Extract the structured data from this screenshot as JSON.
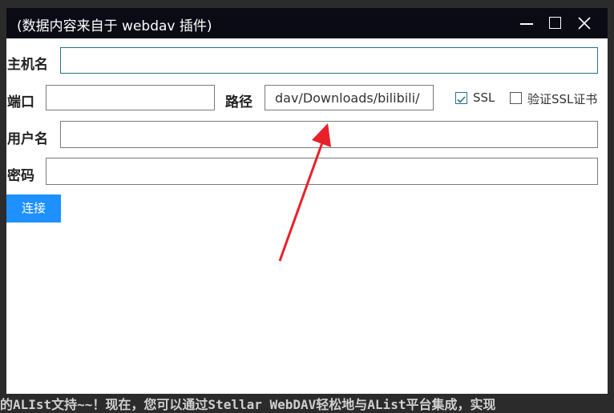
{
  "window": {
    "title": "(数据内容来自于 webdav 插件)"
  },
  "form": {
    "host_label": "主机名",
    "host_value": "",
    "port_label": "端口",
    "port_value": "",
    "path_label": "路径",
    "path_value": "dav/Downloads/bilibili/",
    "ssl_label": "SSL",
    "ssl_checked": true,
    "verify_ssl_label": "验证SSL证书",
    "verify_ssl_checked": false,
    "username_label": "用户名",
    "username_value": "",
    "password_label": "密码",
    "password_value": "",
    "connect_label": "连接"
  },
  "background": {
    "bottom_text": "的ALIst文持~~！现在，您可以通过Stellar WebDAV轻松地与AList平台集成，实现"
  },
  "colors": {
    "titlebar": "#0b0b16",
    "accent": "#1e90ff",
    "arrow": "#e8202a"
  }
}
